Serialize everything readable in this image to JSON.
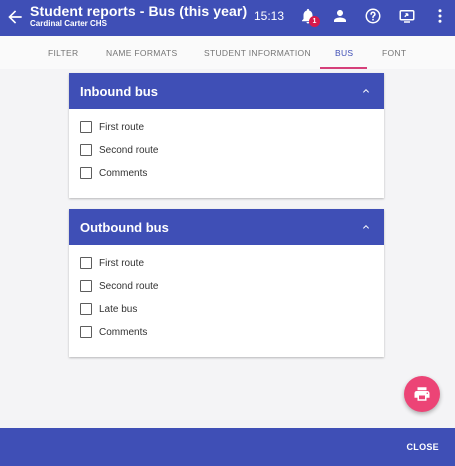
{
  "header": {
    "title": "Student reports - Bus (this year)",
    "subtitle": "Cardinal Carter CHS",
    "time": "15:13",
    "notification_count": "1",
    "icons": [
      "back-arrow-icon",
      "bell-icon",
      "person-icon",
      "help-icon",
      "screen-share-icon",
      "more-vert-icon"
    ]
  },
  "tabs": [
    {
      "label": "FILTER"
    },
    {
      "label": "NAME FORMATS"
    },
    {
      "label": "STUDENT INFORMATION"
    },
    {
      "label": "BUS",
      "active": true
    },
    {
      "label": "FONT"
    }
  ],
  "inbound": {
    "title": "Inbound bus",
    "options": [
      {
        "label": "First route",
        "checked": false
      },
      {
        "label": "Second route",
        "checked": false
      },
      {
        "label": "Comments",
        "checked": false
      }
    ]
  },
  "outbound": {
    "title": "Outbound bus",
    "options": [
      {
        "label": "First route",
        "checked": false
      },
      {
        "label": "Second route",
        "checked": false
      },
      {
        "label": "Late bus",
        "checked": false
      },
      {
        "label": "Comments",
        "checked": false
      }
    ]
  },
  "fab": {
    "icon": "print-icon"
  },
  "footer": {
    "close_label": "CLOSE"
  },
  "colors": {
    "primary": "#3f4fb6",
    "accent": "#ec4476",
    "badge": "#d61a4c"
  }
}
